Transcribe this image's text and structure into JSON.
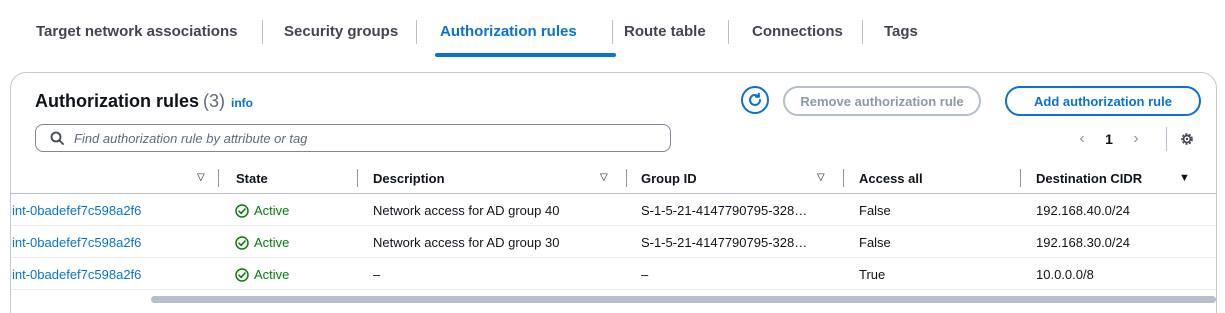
{
  "tabs": [
    {
      "label": "Target network associations"
    },
    {
      "label": "Security groups"
    },
    {
      "label": "Authorization rules"
    },
    {
      "label": "Route table"
    },
    {
      "label": "Connections"
    },
    {
      "label": "Tags"
    }
  ],
  "active_tab": "Authorization rules",
  "panel": {
    "title": "Authorization rules",
    "count": "(3)",
    "info": "info",
    "refresh_icon": "refresh-icon",
    "remove_label": "Remove authorization rule",
    "add_label": "Add authorization rule"
  },
  "search": {
    "placeholder": "Find authorization rule by attribute or tag",
    "value": ""
  },
  "pagination": {
    "prev": "‹",
    "page": "1",
    "next": "›"
  },
  "columns": [
    {
      "label": ""
    },
    {
      "label": "State"
    },
    {
      "label": "Description"
    },
    {
      "label": "Group ID"
    },
    {
      "label": "Access all"
    },
    {
      "label": "Destination CIDR"
    }
  ],
  "rows": [
    {
      "endpoint": "int-0badefef7c598a2f6",
      "state": "Active",
      "description": "Network access for AD group 40",
      "group_id": "S-1-5-21-4147790795-328…",
      "access_all": "False",
      "cidr": "192.168.40.0/24"
    },
    {
      "endpoint": "int-0badefef7c598a2f6",
      "state": "Active",
      "description": "Network access for AD group 30",
      "group_id": "S-1-5-21-4147790795-328…",
      "access_all": "False",
      "cidr": "192.168.30.0/24"
    },
    {
      "endpoint": "int-0badefef7c598a2f6",
      "state": "Active",
      "description": "–",
      "group_id": "–",
      "access_all": "True",
      "cidr": "10.0.0.0/8"
    }
  ],
  "colors": {
    "accent": "#0972d3",
    "success": "#037f0c",
    "disabled": "#8d99a8"
  }
}
